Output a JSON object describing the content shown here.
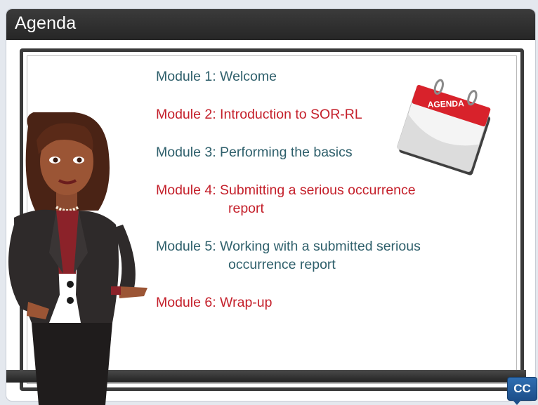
{
  "header": {
    "title": "Agenda"
  },
  "agenda": {
    "items": [
      {
        "line1": "Module 1: Welcome",
        "line2": "",
        "color": "#2e5f6b"
      },
      {
        "line1": "Module 2: Introduction to SOR-RL",
        "line2": "",
        "color": "#c41f2a"
      },
      {
        "line1": "Module 3: Performing the basics",
        "line2": "",
        "color": "#2e5f6b"
      },
      {
        "line1": "Module 4: Submitting a serious occurrence",
        "line2": "report",
        "color": "#c41f2a"
      },
      {
        "line1": "Module 5: Working with a submitted serious",
        "line2": "occurrence report",
        "color": "#2e5f6b"
      },
      {
        "line1": "Module 6: Wrap-up",
        "line2": "",
        "color": "#c41f2a"
      }
    ]
  },
  "calendar": {
    "label": "AGENDA",
    "icon": "calendar-icon"
  },
  "presenter": {
    "icon": "presenter-illustration"
  },
  "controls": {
    "cc_label": "CC"
  },
  "colors": {
    "title_bar": "#2f2f2f",
    "teal_text": "#2e5f6b",
    "red_text": "#c41f2a",
    "cc_blue": "#2563a6"
  }
}
